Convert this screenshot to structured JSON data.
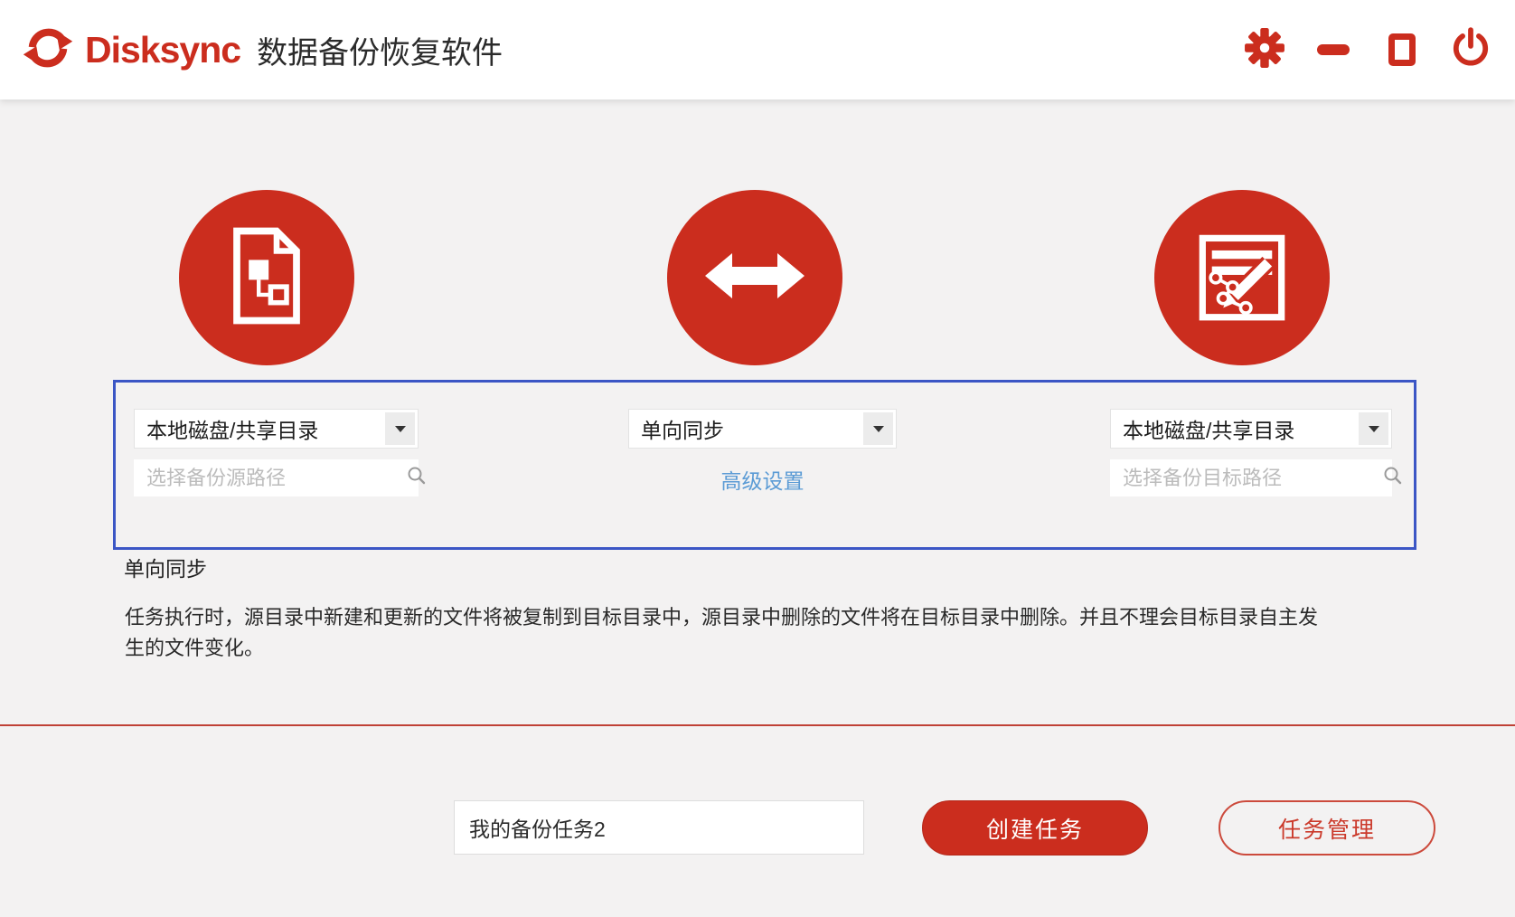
{
  "header": {
    "brand": "Disksync",
    "title": "数据备份恢复软件",
    "controls": {
      "settings_icon": "gear",
      "minimize_icon": "minus-bar",
      "maximize_icon": "square-outline",
      "close_icon": "power"
    },
    "logo_icon": "red-sync-arrows"
  },
  "source_panel": {
    "icon": "document-structure",
    "type_value": "本地磁盘/共享目录",
    "path_placeholder": "选择备份源路径",
    "search_icon": "magnifier"
  },
  "sync_panel": {
    "icon": "two-way-arrow",
    "mode_value": "单向同步",
    "advanced_label": "高级设置"
  },
  "target_panel": {
    "icon": "document-edit-pencil",
    "type_value": "本地磁盘/共享目录",
    "path_placeholder": "选择备份目标路径",
    "search_icon": "magnifier"
  },
  "mode_info": {
    "label": "单向同步",
    "description": "任务执行时，源目录中新建和更新的文件将被复制到目标目录中，源目录中删除的文件将在目标目录中删除。并且不理会目标目录自主发生的文件变化。"
  },
  "footer": {
    "task_name_value": "我的备份任务2",
    "create_label": "创建任务",
    "manage_label": "任务管理"
  },
  "colors": {
    "accent_red": "#cb2d1e",
    "selection_border_blue": "#3b56c5",
    "link_blue": "#5b9bd5",
    "divider_red": "#bf4136",
    "background_gray": "#f3f2f2"
  }
}
